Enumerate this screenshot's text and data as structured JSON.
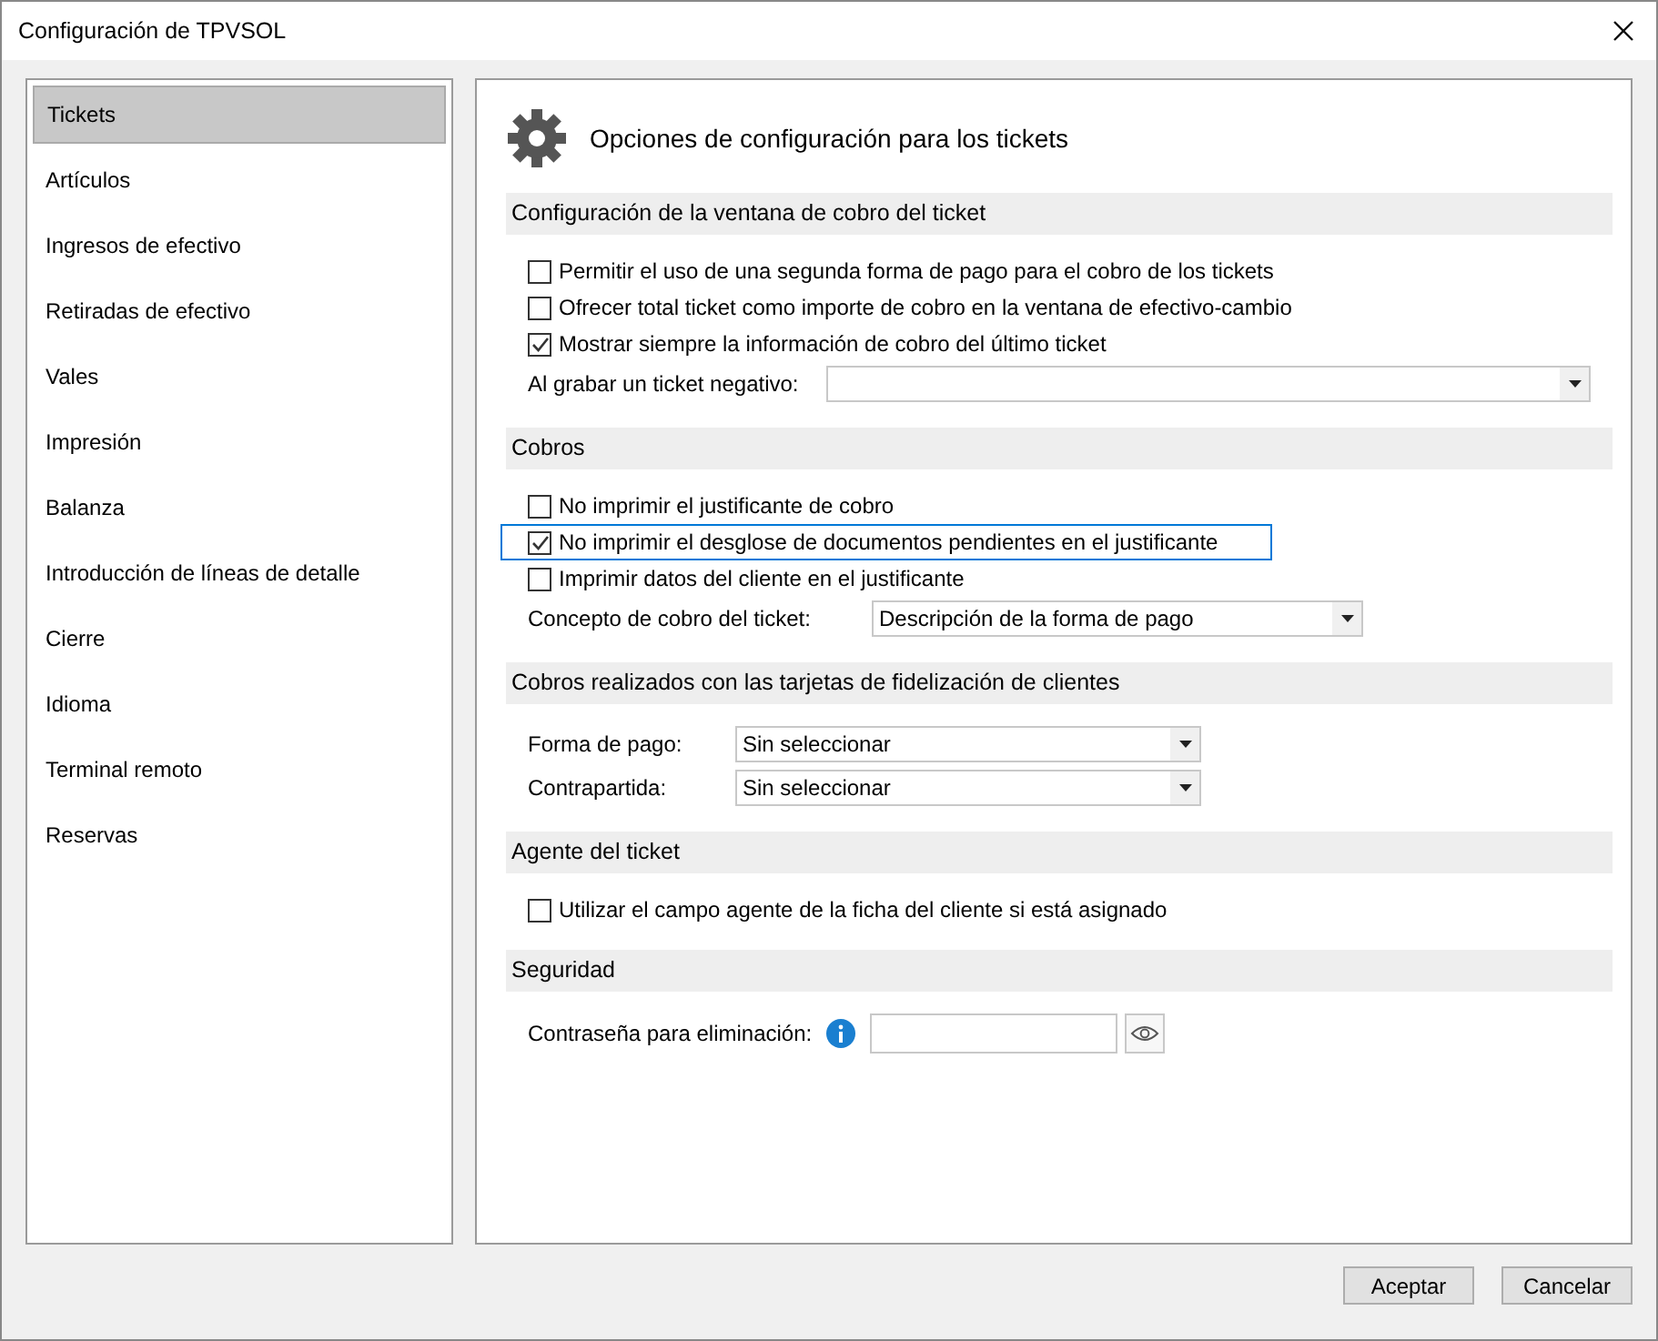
{
  "window": {
    "title": "Configuración de TPVSOL"
  },
  "sidebar": {
    "items": [
      {
        "label": "Tickets",
        "selected": true
      },
      {
        "label": "Artículos",
        "selected": false
      },
      {
        "label": "Ingresos de efectivo",
        "selected": false
      },
      {
        "label": "Retiradas de efectivo",
        "selected": false
      },
      {
        "label": "Vales",
        "selected": false
      },
      {
        "label": "Impresión",
        "selected": false
      },
      {
        "label": "Balanza",
        "selected": false
      },
      {
        "label": "Introducción de líneas de detalle",
        "selected": false
      },
      {
        "label": "Cierre",
        "selected": false
      },
      {
        "label": "Idioma",
        "selected": false
      },
      {
        "label": "Terminal remoto",
        "selected": false
      },
      {
        "label": "Reservas",
        "selected": false
      }
    ]
  },
  "page_title": "Opciones de configuración para los tickets",
  "sections": [
    {
      "title": "Configuración de la ventana de cobro del ticket",
      "rows": [
        {
          "kind": "checkbox",
          "label": "Permitir el uso de una segunda forma de pago para el cobro de los tickets",
          "checked": false,
          "focused": false
        },
        {
          "kind": "checkbox",
          "label": "Ofrecer total ticket como importe de cobro en la ventana de efectivo-cambio",
          "checked": false,
          "focused": false
        },
        {
          "kind": "checkbox",
          "label": "Mostrar siempre la información de cobro del último ticket",
          "checked": true,
          "focused": false
        },
        {
          "kind": "select",
          "label": "Al grabar un ticket negativo:"
        }
      ]
    },
    {
      "title": "Cobros",
      "rows": [
        {
          "kind": "checkbox",
          "label": "No imprimir el justificante de cobro",
          "checked": false,
          "focused": false
        },
        {
          "kind": "checkbox",
          "label": "No imprimir el desglose de documentos pendientes en el justificante",
          "checked": true,
          "focused": true
        },
        {
          "kind": "checkbox",
          "label": "Imprimir datos del cliente en el justificante",
          "checked": false,
          "focused": false
        },
        {
          "kind": "select",
          "label": "Concepto de cobro del ticket:",
          "value": "Descripción de la forma de pago"
        }
      ]
    },
    {
      "title": "Cobros realizados con las tarjetas de fidelización de clientes",
      "rows": [
        {
          "kind": "select",
          "label": "Forma de pago:",
          "value": "Sin seleccionar"
        },
        {
          "kind": "select",
          "label": "Contrapartida:",
          "value": "Sin seleccionar"
        }
      ]
    },
    {
      "title": "Agente del ticket",
      "rows": [
        {
          "kind": "checkbox",
          "label": "Utilizar el campo agente de la ficha del cliente si está asignado",
          "checked": false,
          "focused": false
        }
      ]
    },
    {
      "title": "Seguridad",
      "rows": [
        {
          "kind": "password",
          "label": "Contraseña para eliminación:"
        }
      ]
    }
  ],
  "buttons": [
    "Aceptar",
    "Cancelar"
  ]
}
